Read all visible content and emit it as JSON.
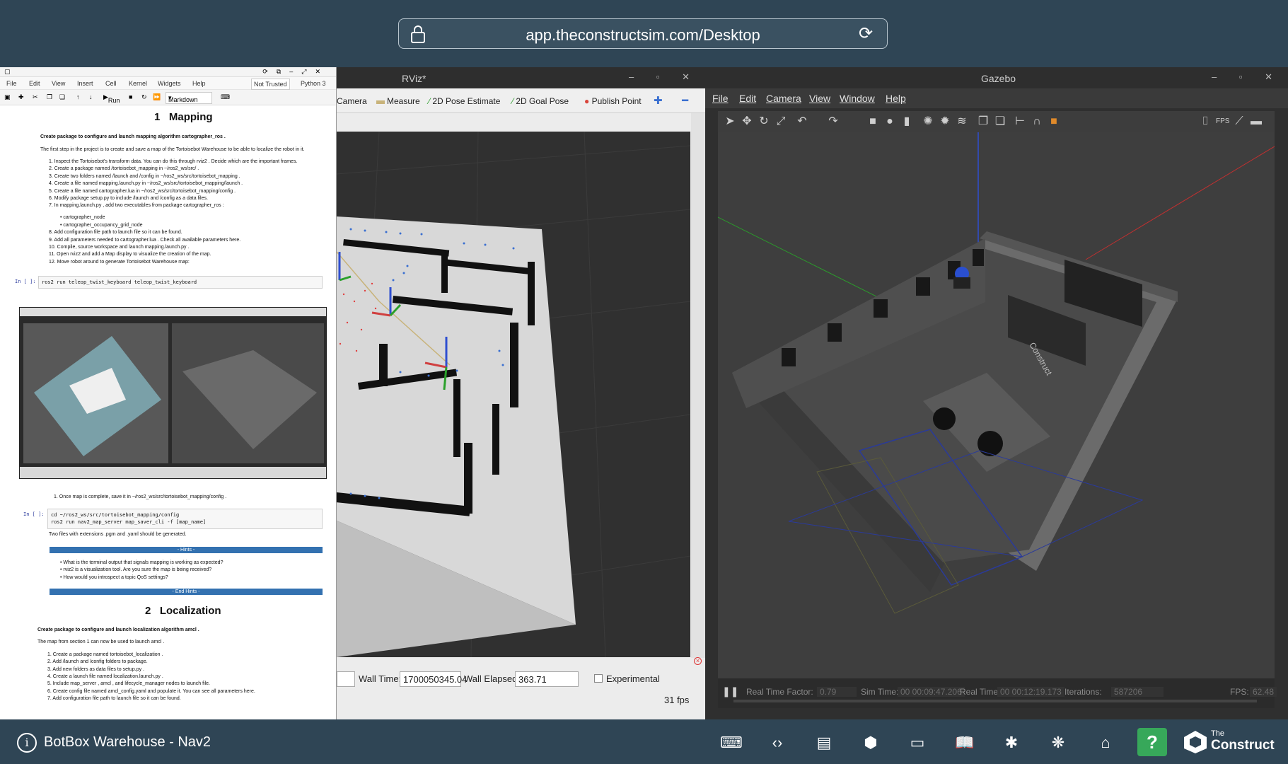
{
  "browser": {
    "url": "app.theconstructsim.com/Desktop"
  },
  "rviz": {
    "title": "RViz*",
    "toolbar": {
      "camera": "Camera",
      "measure": "Measure",
      "pose_estimate": "2D Pose Estimate",
      "goal_pose": "2D Goal Pose",
      "publish_point": "Publish Point"
    },
    "time": {
      "wall_time_label": "Wall Time:",
      "wall_time_value": "1700050345.04",
      "wall_elapsed_label": "Wall Elapsed:",
      "wall_elapsed_value": "363.71",
      "experimental_label": "Experimental",
      "fps": "31 fps"
    }
  },
  "gazebo": {
    "title": "Gazebo",
    "menu": [
      "File",
      "Edit",
      "Camera",
      "View",
      "Window",
      "Help"
    ],
    "status": {
      "rtf_label": "Real Time Factor:",
      "rtf_value": "0.79",
      "sim_time_label": "Sim Time:",
      "sim_time_value": "00 00:09:47.206",
      "real_time_label": "Real Time:",
      "real_time_value": "00 00:12:19.173",
      "iterations_label": "Iterations:",
      "iterations_value": "587206",
      "fps_label": "FPS:",
      "fps_value": "62.48"
    }
  },
  "jupyter": {
    "menu": [
      "File",
      "Edit",
      "View",
      "Insert",
      "Cell",
      "Kernel",
      "Widgets",
      "Help"
    ],
    "trust": "Not Trusted",
    "kernel": "Python 3",
    "run_label": "Run",
    "cell_type": "Markdown",
    "section1": {
      "number": "1",
      "title": "Mapping",
      "subtitle": "Create package to configure and launch mapping algorithm cartographer_ros .",
      "intro": "The first step in the project is to create and save a map of the Tortoisebot Warehouse to be able to localize the robot in it.",
      "steps": [
        "1. Inspect the Tortoisebot's transform data. You can do this through rviz2 . Decide which are the important frames.",
        "2. Create a package named /tortoisebot_mapping in ~/ros2_ws/src/ .",
        "3. Create two folders named /launch and /config in ~/ros2_ws/src/tortoisebot_mapping .",
        "4. Create a file named mapping.launch.py in ~/ros2_ws/src/tortoisebot_mapping/launch .",
        "5. Create a file named cartographer.lua in ~/ros2_ws/src/tortoisebot_mapping/config .",
        "6. Modify package setup.py to include /launch and /config as a data files.",
        "7. In mapping.launch.py , add two executables from package cartographer_ros :"
      ],
      "bullets": [
        "cartographer_node",
        "cartographer_occupancy_grid_node"
      ],
      "steps2": [
        "8. Add configuration file path to launch file so it can be found.",
        "9. Add all parameters needed to cartographer.lua . Check all available parameters here.",
        "10. Compile, source workspace and launch mapping.launch.py .",
        "11. Open rviz2 and add a Map display to visualize the creation of the map.",
        "12. Move robot around to generate Tortoisebot Warehouse map:"
      ],
      "in_label": "In [ ]:",
      "code1": "ros2 run teleop_twist_keyboard teleop_twist_keyboard",
      "save_step": "1. Once map is complete, save it in ~/ros2_ws/src/tortoisebot_mapping/config .",
      "code2": "cd ~/ros2_ws/src/tortoisebot_mapping/config\nros2 run nav2_map_server map_saver_cli -f [map_name]",
      "files_note": "Two files with extensions .pgm and .yaml should be generated.",
      "hints": "- Hints -",
      "hint_items": [
        "What is the terminal output that signals mapping is working as expected?",
        "rviz2 is a visualization tool. Are you sure the map is being received?",
        "How would you introspect a topic QoS settings?"
      ],
      "end_hints": "- End Hints -"
    },
    "section2": {
      "number": "2",
      "title": "Localization",
      "subtitle": "Create package to configure and launch localization algorithm amcl .",
      "intro": "The map from section 1 can now be used to launch amcl .",
      "steps": [
        "1. Create a package named tortoisebot_localization .",
        "2. Add /launch and /config folders to package.",
        "3. Add new folders as data files to setup.py .",
        "4. Create a launch file named localization.launch.py .",
        "5. Include map_server , amcl , and lifecycle_manager nodes to launch file.",
        "6. Create config file named amcl_config.yaml and populate it. You can see all parameters here.",
        "7. Add configuration file path to launch file so it can be found."
      ]
    }
  },
  "bottombar": {
    "title": "BotBox Warehouse - Nav2",
    "logo_small": "The",
    "logo_big": "Construct"
  }
}
